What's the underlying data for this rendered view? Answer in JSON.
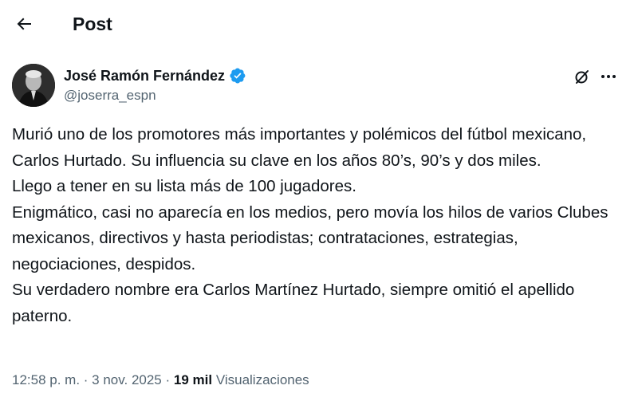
{
  "header": {
    "title": "Post",
    "back_icon": "arrow-left-icon"
  },
  "post": {
    "author": {
      "name": "José Ramón Fernández",
      "handle": "@joserra_espn",
      "verified": true,
      "verified_color": "#1d9bf0"
    },
    "paragraphs": [
      "Murió uno de los promotores más importantes y polémicos del fútbol mexicano, Carlos Hurtado. Su influencia su clave en los años 80’s, 90’s y dos miles.",
      "Llego a tener en su lista más de 100 jugadores.",
      "Enigmático, casi no aparecía en los medios, pero movía los hilos de varios Clubes mexicanos, directivos y hasta periodistas; contrataciones, estrategias, negociaciones, despidos.",
      "Su verdadero nombre era Carlos Martínez Hurtado, siempre omitió el apellido paterno."
    ],
    "meta": {
      "time": "12:58 p. m.",
      "separator": " · ",
      "date": "3 nov. 2025",
      "views_count": "19 mil",
      "views_label": "Visualizaciones"
    }
  },
  "icons": {
    "grok": "grok-icon",
    "more": "more-icon"
  }
}
